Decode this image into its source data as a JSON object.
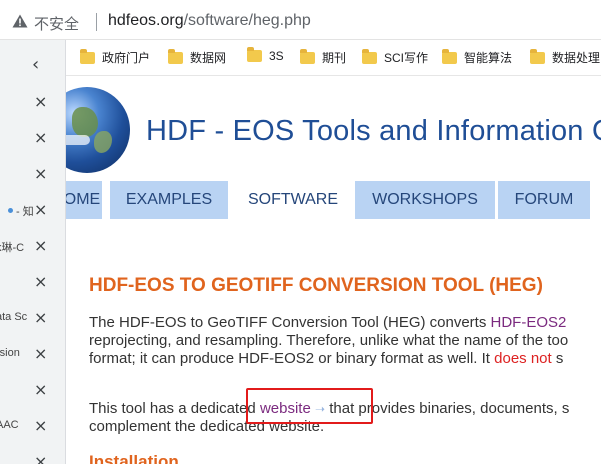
{
  "address_bar": {
    "security_label": "不安全",
    "url_host": "hdfeos.org",
    "url_path": "/software/heg.php"
  },
  "tab_strip": {
    "collapse_icon": "chevron-left-icon",
    "items": [
      {
        "label": ""
      },
      {
        "label": ""
      },
      {
        "label": ""
      },
      {
        "label": "- 知"
      },
      {
        "label": "k琳-C"
      },
      {
        "label": ""
      },
      {
        "label": "ata Sc"
      },
      {
        "label": "rsion"
      },
      {
        "label": ""
      },
      {
        "label": "AAC"
      },
      {
        "label": ""
      }
    ]
  },
  "bookmarks": [
    {
      "label": "政府门户"
    },
    {
      "label": "数据网"
    },
    {
      "label": "3S"
    },
    {
      "label": "期刊"
    },
    {
      "label": "SCI写作"
    },
    {
      "label": "智能算法"
    },
    {
      "label": "数据处理"
    }
  ],
  "site": {
    "title": "HDF - EOS Tools and Information Cen",
    "nav": [
      {
        "label": "OME"
      },
      {
        "label": "EXAMPLES"
      },
      {
        "label": "SOFTWARE"
      },
      {
        "label": "WORKSHOPS"
      },
      {
        "label": "FORUM"
      }
    ]
  },
  "content": {
    "heading": "HDF-EOS TO GEOTIFF CONVERSION TOOL (HEG)",
    "p1": {
      "l1_text": "The HDF-EOS to GeoTIFF Conversion Tool (HEG) converts ",
      "l1_link": "HDF-EOS2",
      "l2": "reprojecting, and resampling. Therefore, unlike what the name of the too",
      "l3_text": "format; it can produce HDF-EOS2 or binary format as well. It ",
      "l3_red": "does not",
      "l3_tail": " s"
    },
    "p2": {
      "l1_pre": "This tool has a dedicated ",
      "l1_link": "website",
      "l1_arrow": "➝",
      "l1_post": " that provides binaries, documents, s",
      "l2": "complement the dedicated website."
    },
    "sub": "Installation"
  },
  "colors": {
    "accent_orange": "#e0641e",
    "nav_blue": "#b9d3f3",
    "title_blue": "#1f4e96",
    "highlight_red": "#e21b1b"
  }
}
